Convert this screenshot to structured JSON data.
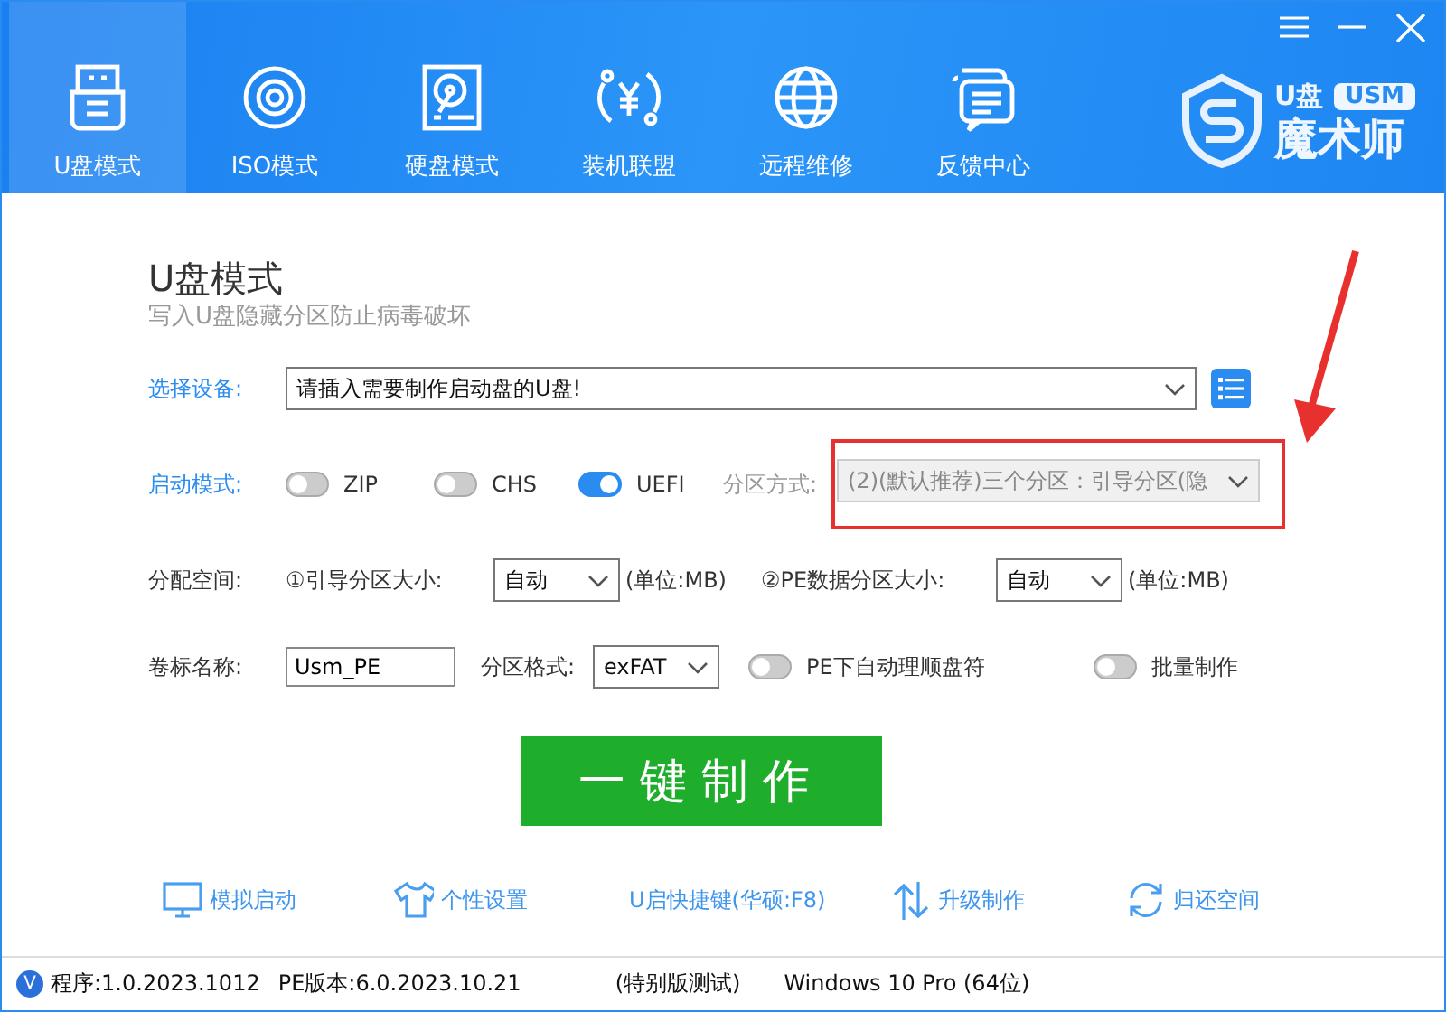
{
  "window_controls": [
    {
      "kind": "menu"
    },
    {
      "kind": "minimize"
    },
    {
      "kind": "close"
    }
  ],
  "tabs": [
    {
      "label": "U盘模式",
      "kind": "usb",
      "selected": true
    },
    {
      "label": "ISO模式",
      "kind": "disc",
      "selected": false
    },
    {
      "label": "硬盘模式",
      "kind": "disk",
      "selected": false
    },
    {
      "label": "装机联盟",
      "kind": "yen",
      "selected": false
    },
    {
      "label": "远程维修",
      "kind": "globe",
      "selected": false
    },
    {
      "label": "反馈中心",
      "kind": "chat",
      "selected": false
    }
  ],
  "logo": {
    "top": "U盘",
    "badge": "USM",
    "bottom": "魔术师"
  },
  "heading": {
    "title": "U盘模式",
    "subtitle": "写入U盘隐藏分区防止病毒破坏"
  },
  "device": {
    "label": "选择设备:",
    "value": "请插入需要制作启动盘的U盘!"
  },
  "boot_mode": {
    "label": "启动模式:",
    "options": [
      {
        "label": "ZIP",
        "on": false
      },
      {
        "label": "CHS",
        "on": false
      },
      {
        "label": "UEFI",
        "on": true
      }
    ]
  },
  "partition_scheme": {
    "label": "分区方式:",
    "value": "(2)(默认推荐)三个分区：引导分区(隐",
    "disabled": true,
    "highlighted": true
  },
  "allocation": {
    "label": "分配空间:",
    "boot_size": {
      "label": "①引导分区大小:",
      "value": "自动",
      "unit": "(单位:MB)"
    },
    "pe_size": {
      "label": "②PE数据分区大小:",
      "value": "自动",
      "unit": "(单位:MB)"
    }
  },
  "volume": {
    "label": "卷标名称:",
    "value": "Usm_PE",
    "format_label": "分区格式:",
    "format_value": "exFAT"
  },
  "options": [
    {
      "label": "PE下自动理顺盘符",
      "on": false
    },
    {
      "label": "批量制作",
      "on": false
    }
  ],
  "make_button": "一键制作",
  "links": [
    {
      "label": "模拟启动",
      "kind": "monitor"
    },
    {
      "label": "个性设置",
      "kind": "shirt"
    },
    {
      "label": "U启快捷键(华硕:F8)",
      "kind": "text"
    },
    {
      "label": "升级制作",
      "kind": "updown"
    },
    {
      "label": "归还空间",
      "kind": "cycle"
    }
  ],
  "status_bar": {
    "badge": "V",
    "program": "程序:1.0.2023.1012",
    "pe": "PE版本:6.0.2023.10.21",
    "edition": "(特别版测试)",
    "os": "Windows 10 Pro (64位)"
  }
}
